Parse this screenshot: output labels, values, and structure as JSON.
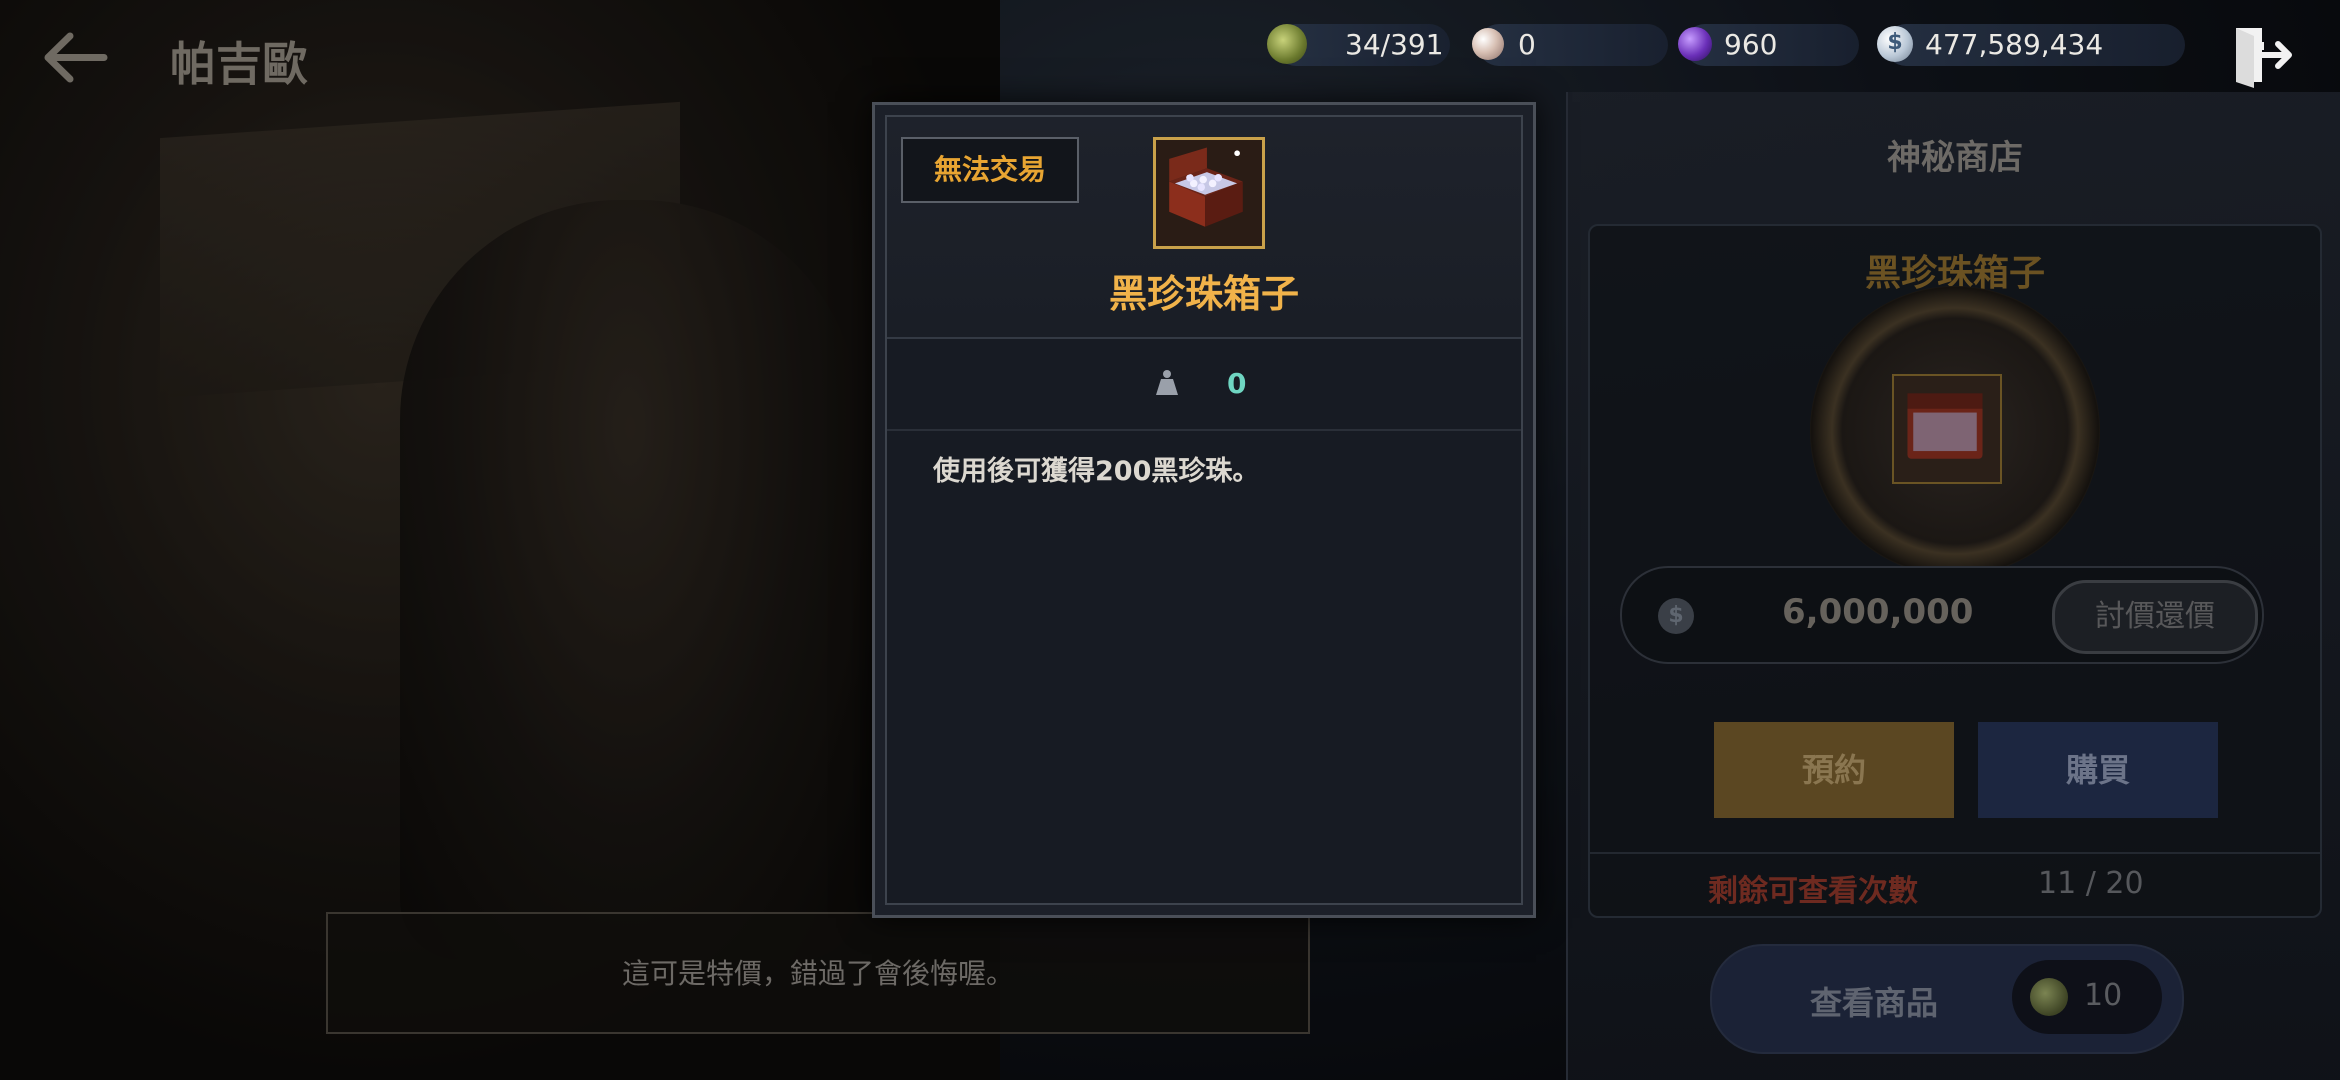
{
  "header": {
    "title": "帕吉歐"
  },
  "currencies": [
    {
      "icon": "energy-icon",
      "value": "34/391"
    },
    {
      "icon": "pearl-icon",
      "value": "0"
    },
    {
      "icon": "amethyst-icon",
      "value": "960"
    },
    {
      "icon": "silver-icon",
      "value": "477,589,434"
    }
  ],
  "tooltip": {
    "badge": "無法交易",
    "item_name": "黑珍珠箱子",
    "weight": "0",
    "description": "使用後可獲得200黑珍珠。"
  },
  "shop": {
    "title": "神秘商店",
    "item_name": "黑珍珠箱子",
    "price": "6,000,000",
    "haggle_label": "討價還價",
    "reserve_label": "預約",
    "buy_label": "購買",
    "views_label": "剩餘可查看次數",
    "views_value": "11 / 20",
    "view_goods_label": "查看商品",
    "view_goods_cost": "10"
  },
  "npc_dialog": "這可是特價，錯過了會後悔喔。",
  "colors": {
    "accent_gold": "#f1b34a",
    "badge_orange": "#e8a532",
    "weight_teal": "#6fd6c2"
  }
}
